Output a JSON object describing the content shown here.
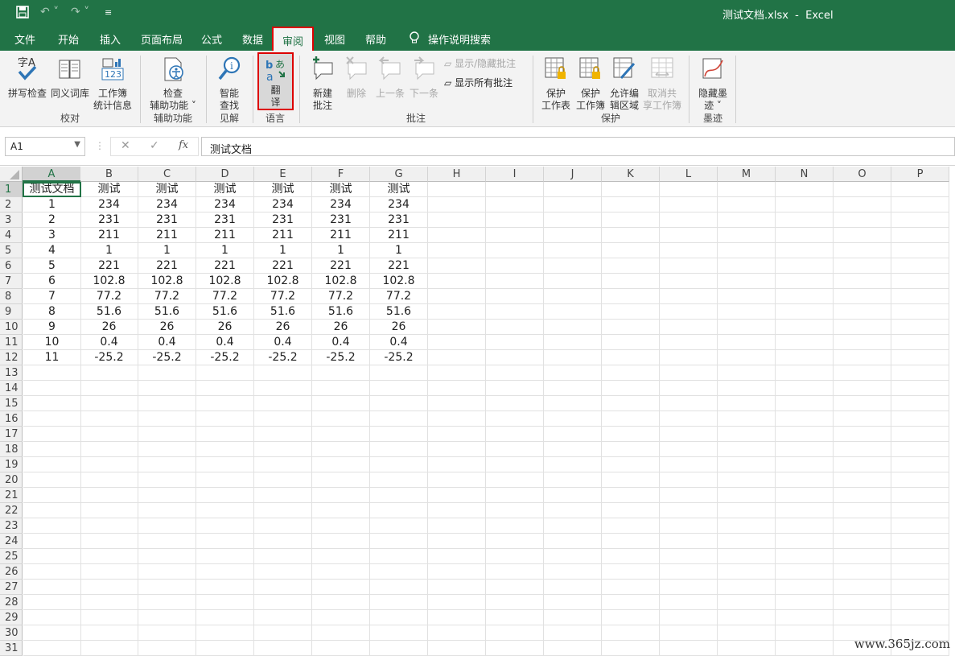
{
  "titlebar": {
    "title": "测试文档.xlsx  -  Excel"
  },
  "tabs": [
    {
      "label": "文件"
    },
    {
      "label": "开始"
    },
    {
      "label": "插入"
    },
    {
      "label": "页面布局"
    },
    {
      "label": "公式"
    },
    {
      "label": "数据"
    },
    {
      "label": "审阅"
    },
    {
      "label": "视图"
    },
    {
      "label": "帮助"
    },
    {
      "label": "操作说明搜索"
    }
  ],
  "active_tab": "审阅",
  "ribbon": {
    "spell": "拼写检查",
    "thesaurus": "同义词库",
    "wbstats": "工作簿\n统计信息",
    "g_proof": "校对",
    "access": "检查\n辅助功能 ˅",
    "g_access": "辅助功能",
    "smart": "智能\n查找",
    "g_insight": "见解",
    "translate": "翻\n译",
    "g_lang": "语言",
    "newcomment": "新建\n批注",
    "delete": "删除",
    "prev": "上一条",
    "next": "下一条",
    "showhide": "显示/隐藏批注",
    "showall": "显示所有批注",
    "g_comments": "批注",
    "protsheet": "保护\n工作表",
    "protwb": "保护\n工作簿",
    "allow": "允许编\n辑区域",
    "unshare": "取消共\n享工作簿",
    "g_protect": "保护",
    "hideink": "隐藏墨\n迹 ˅",
    "g_ink": "墨迹"
  },
  "formula_bar": {
    "name_box": "A1",
    "fx": "fx",
    "content": "测试文档"
  },
  "columns": [
    "A",
    "B",
    "C",
    "D",
    "E",
    "F",
    "G",
    "H",
    "I",
    "J",
    "K",
    "L",
    "M",
    "N",
    "O",
    "P"
  ],
  "rows": [
    [
      "测试文档",
      "测试",
      "测试",
      "测试",
      "测试",
      "测试",
      "测试"
    ],
    [
      "1",
      "234",
      "234",
      "234",
      "234",
      "234",
      "234"
    ],
    [
      "2",
      "231",
      "231",
      "231",
      "231",
      "231",
      "231"
    ],
    [
      "3",
      "211",
      "211",
      "211",
      "211",
      "211",
      "211"
    ],
    [
      "4",
      "1",
      "1",
      "1",
      "1",
      "1",
      "1"
    ],
    [
      "5",
      "221",
      "221",
      "221",
      "221",
      "221",
      "221"
    ],
    [
      "6",
      "102.8",
      "102.8",
      "102.8",
      "102.8",
      "102.8",
      "102.8"
    ],
    [
      "7",
      "77.2",
      "77.2",
      "77.2",
      "77.2",
      "77.2",
      "77.2"
    ],
    [
      "8",
      "51.6",
      "51.6",
      "51.6",
      "51.6",
      "51.6",
      "51.6"
    ],
    [
      "9",
      "26",
      "26",
      "26",
      "26",
      "26",
      "26"
    ],
    [
      "10",
      "0.4",
      "0.4",
      "0.4",
      "0.4",
      "0.4",
      "0.4"
    ],
    [
      "11",
      "-25.2",
      "-25.2",
      "-25.2",
      "-25.2",
      "-25.2",
      "-25.2"
    ]
  ],
  "row_count": 31,
  "selected_cell": "A1",
  "watermark": "www.365jz.com",
  "colors": {
    "accent": "#217346",
    "highlight": "#dd0000"
  }
}
